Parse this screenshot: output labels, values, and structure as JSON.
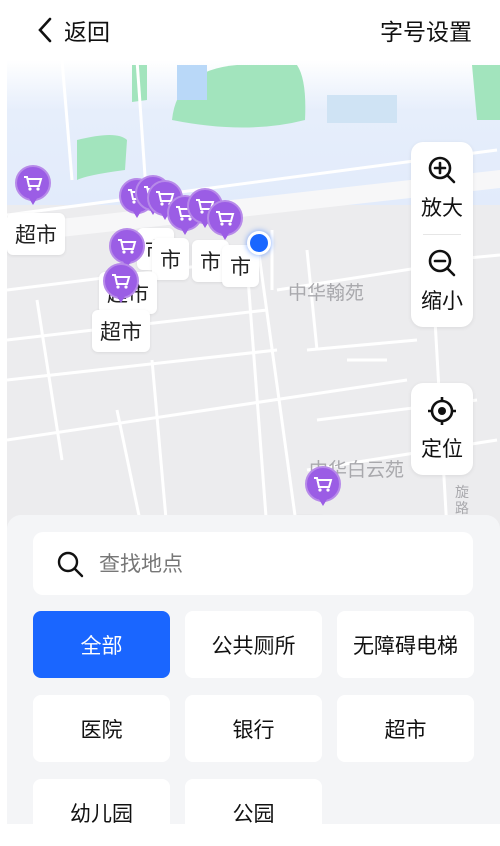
{
  "header": {
    "back_label": "返回",
    "font_setting_label": "字号设置"
  },
  "map": {
    "place_labels": [
      "中华翰苑",
      "中华白云苑",
      "旋路"
    ],
    "poi_label": "超市",
    "poi_labels": [
      "超市",
      "市",
      "市",
      "市",
      "市",
      "超市",
      "超市",
      "市"
    ],
    "controls": {
      "zoom_in": "放大",
      "zoom_out": "缩小",
      "locate": "定位"
    },
    "poi_color": "#9b5de5",
    "location_color": "#1966ff"
  },
  "search": {
    "placeholder": "查找地点",
    "value": ""
  },
  "categories": [
    {
      "label": "全部",
      "active": true
    },
    {
      "label": "公共厕所",
      "active": false
    },
    {
      "label": "无障碍电梯",
      "active": false
    },
    {
      "label": "医院",
      "active": false
    },
    {
      "label": "银行",
      "active": false
    },
    {
      "label": "超市",
      "active": false
    },
    {
      "label": "幼儿园",
      "active": false
    },
    {
      "label": "公园",
      "active": false
    }
  ],
  "accent_color": "#1a66ff"
}
